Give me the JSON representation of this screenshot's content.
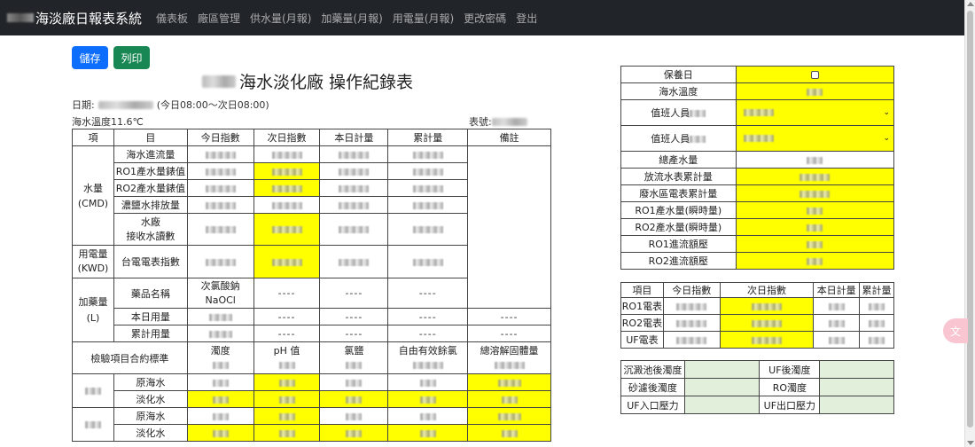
{
  "nav": {
    "brand": "海淡廠日報表系統",
    "links": [
      "儀表板",
      "廠區管理",
      "供水量(月報)",
      "加藥量(月報)",
      "用電量(月報)",
      "更改密碼",
      "登出"
    ]
  },
  "toolbar": {
    "save": "儲存",
    "print": "列印"
  },
  "title": "海水淡化廠 操作紀錄表",
  "date_label": "日期:",
  "date_range": "(今日08:00～次日08:00)",
  "sea_temp_line": "海水溫度11.6℃",
  "form_no_label": "表號:",
  "main": {
    "headers": [
      "項",
      "目",
      "今日指數",
      "次日指數",
      "本日計量",
      "累計量",
      "備註"
    ],
    "water_group": "水量\n(CMD)",
    "water_rows": [
      "海水進流量",
      "RO1產水量錶值",
      "RO2產水量錶值",
      "濃鹽水排放量",
      "水廠\n接收水讀數"
    ],
    "power_group": "用電量\n(KWD)",
    "power_row": "台電電表指數",
    "chem_group": "加藥量\n(L)",
    "chem_rows": [
      "藥品名稱",
      "本日用量",
      "累計用量"
    ],
    "chem_name": "次氯酸鈉\nNaOCl",
    "dash": "----",
    "test_header": "檢驗項目合約標準",
    "test_cols": [
      "濁度",
      "pH 值",
      "氯鹽",
      "自由有效餘氯",
      "總溶解固體量"
    ],
    "test_rows": [
      "原海水",
      "淡化水",
      "原海水",
      "淡化水"
    ]
  },
  "right": {
    "rows": [
      "保養日",
      "海水溫度",
      "值班人員",
      "值班人員",
      "總產水量",
      "放流水表累計量",
      "廢水區電表累計量",
      "RO1產水量(瞬時量)",
      "RO2產水量(瞬時量)",
      "RO1進流額壓",
      "RO2進流額壓"
    ],
    "meter_headers": [
      "項目",
      "今日指數",
      "次日指數",
      "本日計量",
      "累計量"
    ],
    "meters": [
      "RO1電表",
      "RO2電表",
      "UF電表"
    ],
    "turbidity": [
      [
        "沉澱池後濁度",
        "UF後濁度"
      ],
      [
        "砂濾後濁度",
        "RO濁度"
      ],
      [
        "UF入口壓力",
        "UF出口壓力"
      ]
    ]
  },
  "colors": {
    "navbar": "#212529",
    "save": "#0d6efd",
    "print": "#198754",
    "highlight": "#ffff00",
    "green_cell": "#e2efda"
  }
}
